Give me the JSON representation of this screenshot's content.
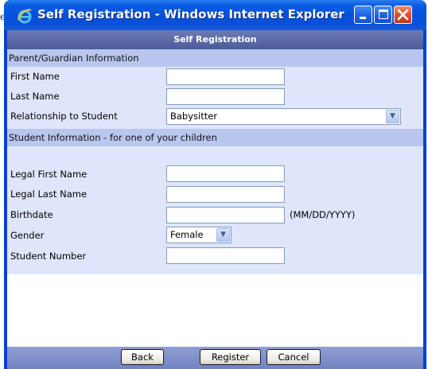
{
  "background_text": "e",
  "window": {
    "title": "Self Registration - Windows Internet Explorer"
  },
  "form": {
    "title": "Self Registration",
    "parent_section": {
      "header": "Parent/Guardian Information",
      "first_name_label": "First Name",
      "first_name_value": "",
      "last_name_label": "Last Name",
      "last_name_value": "",
      "relationship_label": "Relationship to Student",
      "relationship_value": "Babysitter"
    },
    "student_section": {
      "header": "Student Information - for one of your children",
      "legal_first_label": "Legal First Name",
      "legal_first_value": "",
      "legal_last_label": "Legal Last Name",
      "legal_last_value": "",
      "birthdate_label": "Birthdate",
      "birthdate_value": "",
      "birthdate_hint": "(MM/DD/YYYY)",
      "gender_label": "Gender",
      "gender_value": "Female",
      "student_number_label": "Student Number",
      "student_number_value": ""
    },
    "buttons": {
      "back": "Back",
      "register": "Register",
      "cancel": "Cancel"
    }
  },
  "colors": {
    "titlebar": "#0551dc",
    "form_title_bar": "#4c5b9a",
    "section_header": "#b9c7ee",
    "section_body": "#dfe6fb",
    "footer": "#7383c0"
  },
  "icons": {
    "app": "internet-explorer-icon",
    "minimize": "minimize-icon",
    "maximize": "maximize-icon",
    "close": "close-icon",
    "dropdown": "chevron-down-icon"
  }
}
